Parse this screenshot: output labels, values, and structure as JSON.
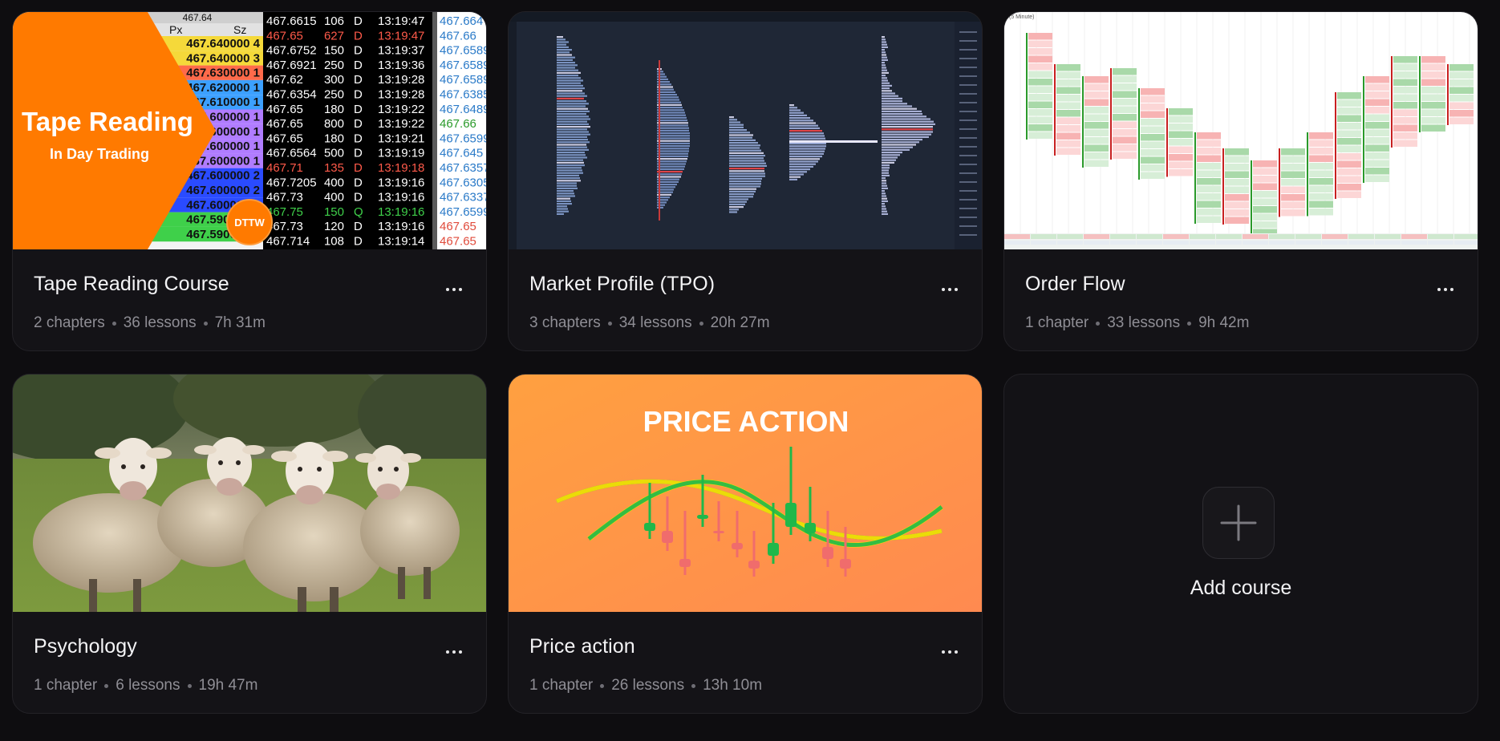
{
  "courses": [
    {
      "title": "Tape Reading Course",
      "chapters": "2 chapters",
      "lessons": "36 lessons",
      "duration": "7h 31m",
      "thumb": {
        "title": "Tape Reading",
        "subtitle": "In Day Trading",
        "badge": "DTTW",
        "header_value": "467.64",
        "col_px": "Px",
        "col_sz": "Sz",
        "left_rows": [
          "467.640000 4",
          "467.640000 3",
          "467.630000 1",
          "467.620000 1",
          "467.610000 1",
          "467.600000 1",
          "467.600000 1",
          "467.600000 1",
          "467.600000 1",
          "467.600000 2",
          "467.600000 2",
          "467.600000 1",
          "467.590000 1",
          "467.590000 1"
        ],
        "rows": [
          {
            "px": "467.6615",
            "sz": "106",
            "t": "D",
            "time": "13:19:47",
            "r": "467.664"
          },
          {
            "px": "467.65",
            "sz": "627",
            "t": "D",
            "time": "13:19:47",
            "r": "467.66"
          },
          {
            "px": "467.6752",
            "sz": "150",
            "t": "D",
            "time": "13:19:37",
            "r": "467.6589"
          },
          {
            "px": "467.6921",
            "sz": "250",
            "t": "D",
            "time": "13:19:36",
            "r": "467.6589"
          },
          {
            "px": "467.62",
            "sz": "300",
            "t": "D",
            "time": "13:19:28",
            "r": "467.6589"
          },
          {
            "px": "467.6354",
            "sz": "250",
            "t": "D",
            "time": "13:19:28",
            "r": "467.6385"
          },
          {
            "px": "467.65",
            "sz": "180",
            "t": "D",
            "time": "13:19:22",
            "r": "467.6489"
          },
          {
            "px": "467.65",
            "sz": "800",
            "t": "D",
            "time": "13:19:22",
            "r": "467.66"
          },
          {
            "px": "467.65",
            "sz": "180",
            "t": "D",
            "time": "13:19:21",
            "r": "467.6599"
          },
          {
            "px": "467.6564",
            "sz": "500",
            "t": "D",
            "time": "13:19:19",
            "r": "467.645"
          },
          {
            "px": "467.71",
            "sz": "135",
            "t": "D",
            "time": "13:19:18",
            "r": "467.6357"
          },
          {
            "px": "467.7205",
            "sz": "400",
            "t": "D",
            "time": "13:19:16",
            "r": "467.6305"
          },
          {
            "px": "467.73",
            "sz": "400",
            "t": "D",
            "time": "13:19:16",
            "r": "467.6337"
          },
          {
            "px": "467.75",
            "sz": "150",
            "t": "Q",
            "time": "13:19:16",
            "r": "467.6599"
          },
          {
            "px": "467.73",
            "sz": "120",
            "t": "D",
            "time": "13:19:16",
            "r": "467.65"
          },
          {
            "px": "467.714",
            "sz": "108",
            "t": "D",
            "time": "13:19:14",
            "r": "467.65"
          }
        ]
      }
    },
    {
      "title": "Market Profile (TPO)",
      "chapters": "3 chapters",
      "lessons": "34 lessons",
      "duration": "20h 27m"
    },
    {
      "title": "Order Flow",
      "chapters": "1 chapter",
      "lessons": "33 lessons",
      "duration": "9h 42m",
      "thumb": {
        "label": "(5 Minute)"
      }
    },
    {
      "title": "Psychology",
      "chapters": "1 chapter",
      "lessons": "6 lessons",
      "duration": "19h 47m"
    },
    {
      "title": "Price action",
      "chapters": "1 chapter",
      "lessons": "26 lessons",
      "duration": "13h 10m",
      "thumb": {
        "title": "PRICE ACTION"
      }
    }
  ],
  "add_course": {
    "label": "Add course"
  },
  "colors": {
    "background": "#0e0d10",
    "card": "#141317",
    "tape_orange": "#ff7a00",
    "price_action_orange": "#ff9a45",
    "candle_green": "#1fb84a",
    "candle_red": "#f06c6c"
  }
}
